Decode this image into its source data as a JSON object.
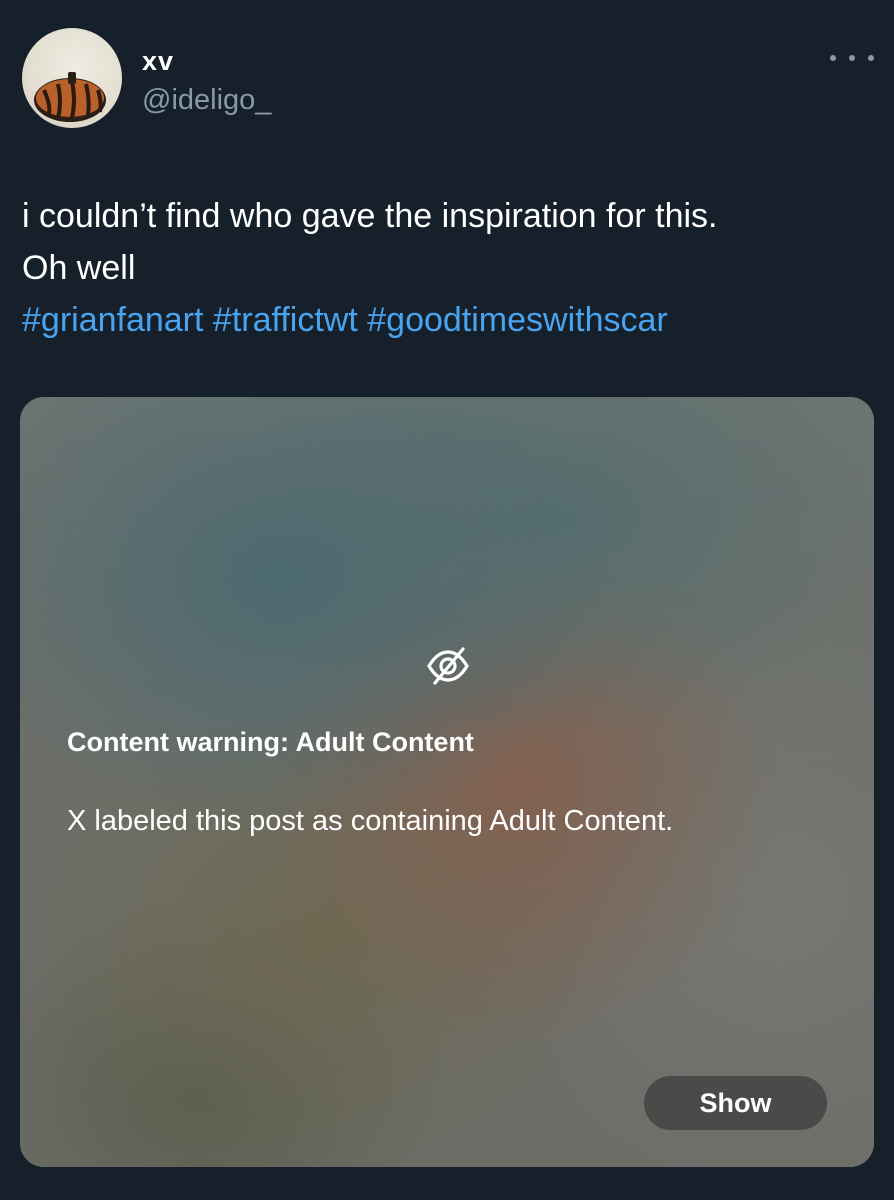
{
  "author": {
    "display_name": "xv",
    "handle": "@ideligo_"
  },
  "post": {
    "text_line1": "i couldn’t find who gave the inspiration for this.",
    "text_line2": "Oh well",
    "hashtags": [
      "#grianfanart",
      "#traffictwt",
      "#goodtimeswithscar"
    ]
  },
  "media": {
    "warning_title": "Content warning: Adult Content",
    "warning_description": "X labeled this post as containing Adult Content.",
    "show_label": "Show"
  },
  "icons": {
    "more": "more-horizontal-icon",
    "warning": "eye-slash-icon"
  },
  "colors": {
    "background": "#15202b",
    "hashtag": "#4aa3ee",
    "secondary_text": "#8b98a5"
  }
}
